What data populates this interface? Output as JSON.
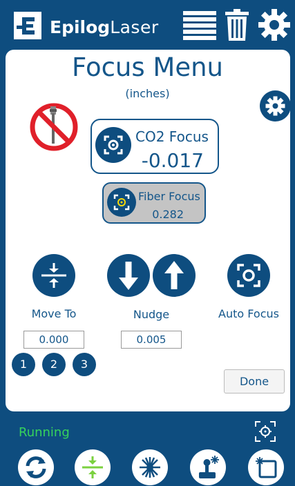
{
  "header": {
    "brand_bold": "Epilog",
    "brand_light": "Laser",
    "icons": [
      "epilog-logo-icon",
      "job-list-icon",
      "trash-icon",
      "settings-icon"
    ]
  },
  "focus_menu": {
    "title": "Focus Menu",
    "units": "(inches)",
    "co2": {
      "label": "CO2 Focus",
      "value": "-0.017"
    },
    "fiber": {
      "label": "Fiber Focus",
      "value": "0.282"
    }
  },
  "controls": {
    "move_to": {
      "label": "Move To",
      "value": "0.000"
    },
    "nudge": {
      "label": "Nudge",
      "value": "0.005"
    },
    "auto_focus": {
      "label": "Auto Focus"
    },
    "presets": [
      "1",
      "2",
      "3"
    ],
    "done_label": "Done"
  },
  "status": {
    "text": "Running",
    "color": "#36d35c"
  },
  "bottom_bar": {
    "icons": [
      "refresh-icon",
      "focus-move-icon",
      "laser-icon",
      "joystick-icon",
      "laser-frame-icon"
    ]
  },
  "colors": {
    "brand_blue": "#0e4d7f",
    "text_blue": "#14568a",
    "accent_green": "#7bd13f"
  }
}
